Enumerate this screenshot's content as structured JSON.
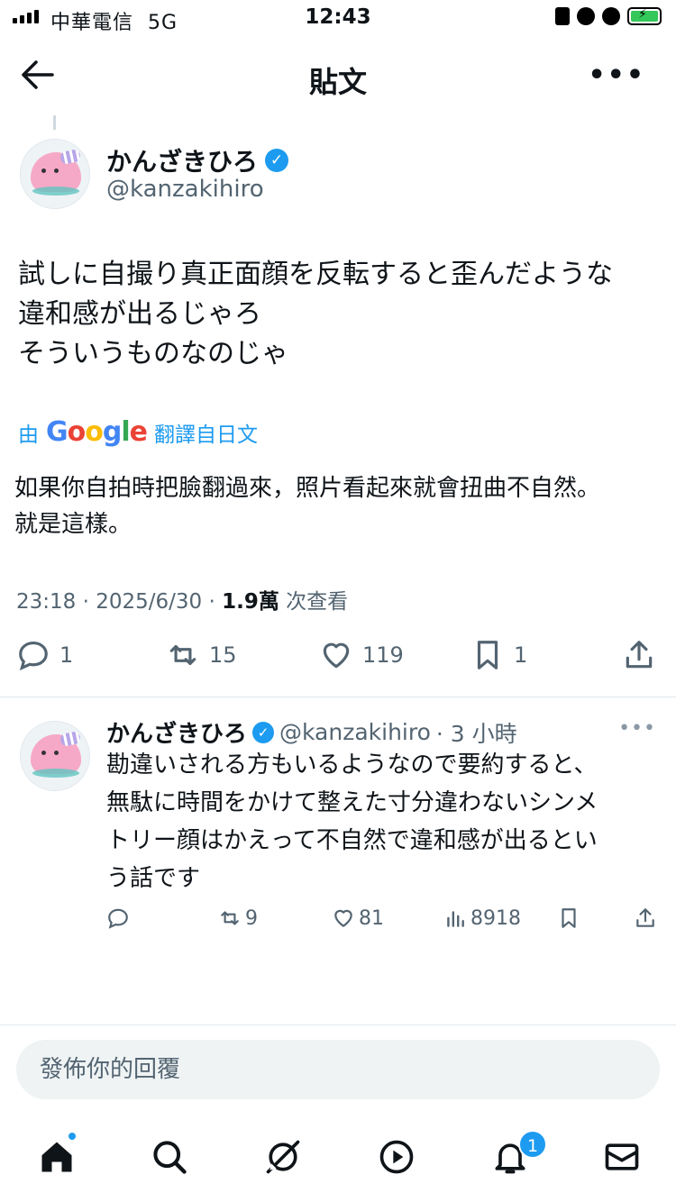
{
  "status": {
    "carrier": "中華電信",
    "network": "5G",
    "time": "12:43"
  },
  "header": {
    "title": "貼文"
  },
  "tweet": {
    "author_name": "かんざきひろ",
    "author_handle": "@kanzakihiro",
    "text": "試しに自撮り真正面顔を反転すると歪んだような\n違和感が出るじゃろ\nそういうものなのじゃ",
    "translate_prefix": "由",
    "translate_brand": "Google",
    "translate_suffix": "翻譯自日文",
    "translation": "如果你自拍時把臉翻過來，照片看起來就會扭曲不自然。\n就是這樣。",
    "timestamp": "23:18 · 2025/6/30 · ",
    "views_count": "1.9萬",
    "views_label": " 次查看",
    "replies": "1",
    "retweets": "15",
    "likes": "119",
    "bookmarks": "1"
  },
  "reply": {
    "author_name": "かんざきひろ",
    "author_handle": "@kanzakihiro",
    "time_ago": "· 3 小時",
    "text": "勘違いされる方もいるようなので要約すると、\n無駄に時間をかけて整えた寸分違わないシンメ\nトリー顔はかえって不自然で違和感が出るとい\nう話です",
    "retweets": "9",
    "likes": "81",
    "views": "8918"
  },
  "reply_box": {
    "placeholder": "發佈你的回覆"
  },
  "tabbar": {
    "notification_badge": "1"
  },
  "colors": {
    "accent": "#1d9bf0",
    "text": "#0f1419",
    "muted": "#536471"
  }
}
